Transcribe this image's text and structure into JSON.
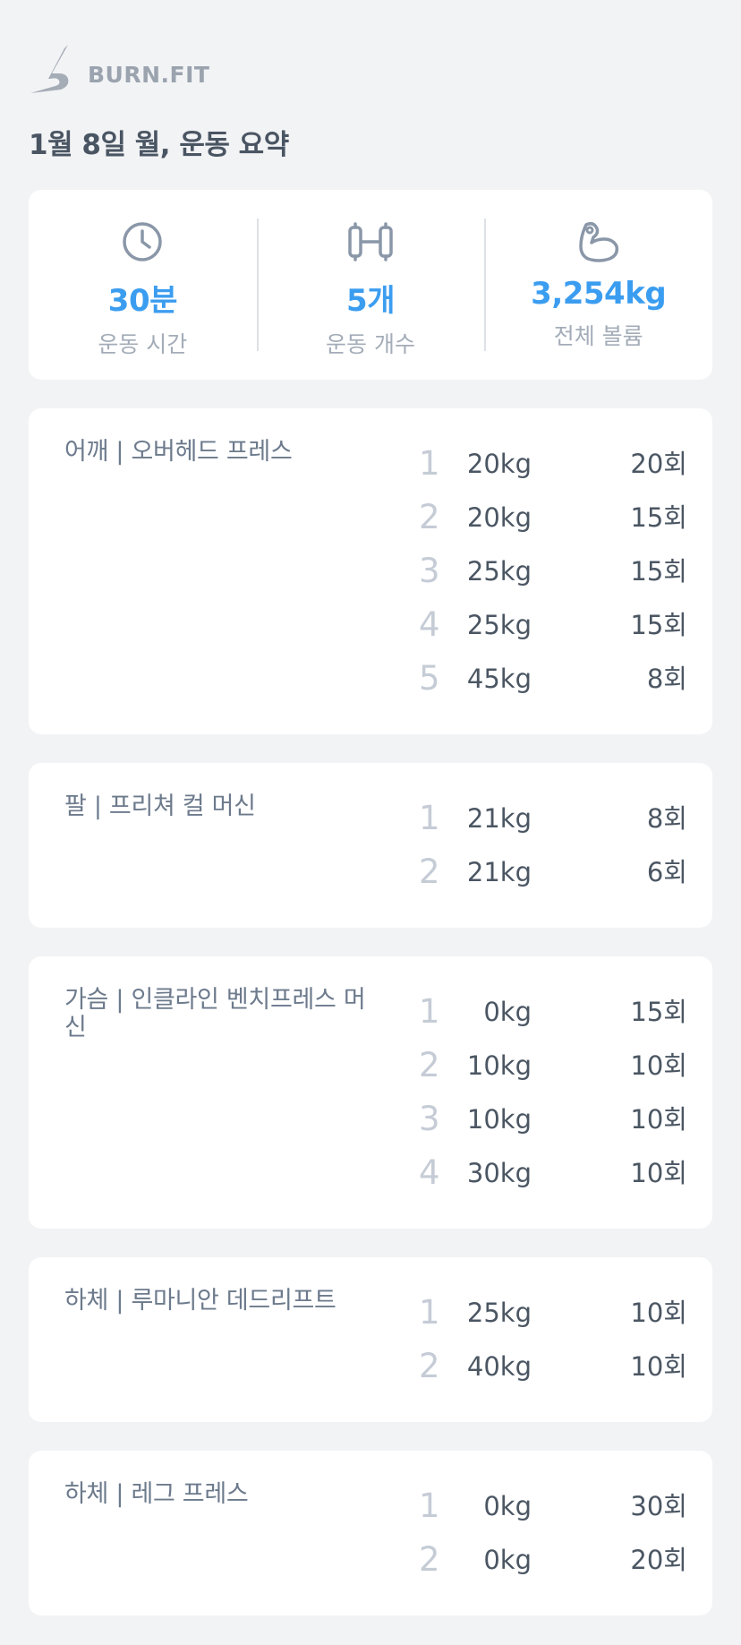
{
  "app": {
    "logo_text": "BURN.FIT"
  },
  "header": {
    "title": "1월 8일 월, 운동 요약"
  },
  "summary": {
    "time": {
      "value": "30분",
      "label": "운동 시간",
      "icon": "clock-icon"
    },
    "count": {
      "value": "5개",
      "label": "운동 개수",
      "icon": "dumbbell-icon"
    },
    "volume": {
      "value": "3,254kg",
      "label": "전체 볼륨",
      "icon": "flexed-arm-icon"
    }
  },
  "colors": {
    "accent": "#3b9df0",
    "background": "#f2f3f5",
    "card": "#ffffff"
  },
  "exercises": [
    {
      "name": "어깨 | 오버헤드 프레스",
      "sets": [
        {
          "num": "1",
          "weight": "20kg",
          "reps": "20회"
        },
        {
          "num": "2",
          "weight": "20kg",
          "reps": "15회"
        },
        {
          "num": "3",
          "weight": "25kg",
          "reps": "15회"
        },
        {
          "num": "4",
          "weight": "25kg",
          "reps": "15회"
        },
        {
          "num": "5",
          "weight": "45kg",
          "reps": "8회"
        }
      ]
    },
    {
      "name": "팔 | 프리쳐 컬 머신",
      "sets": [
        {
          "num": "1",
          "weight": "21kg",
          "reps": "8회"
        },
        {
          "num": "2",
          "weight": "21kg",
          "reps": "6회"
        }
      ]
    },
    {
      "name": "가슴 | 인클라인 벤치프레스 머신",
      "sets": [
        {
          "num": "1",
          "weight": "0kg",
          "reps": "15회"
        },
        {
          "num": "2",
          "weight": "10kg",
          "reps": "10회"
        },
        {
          "num": "3",
          "weight": "10kg",
          "reps": "10회"
        },
        {
          "num": "4",
          "weight": "30kg",
          "reps": "10회"
        }
      ]
    },
    {
      "name": "하체 | 루마니안 데드리프트",
      "sets": [
        {
          "num": "1",
          "weight": "25kg",
          "reps": "10회"
        },
        {
          "num": "2",
          "weight": "40kg",
          "reps": "10회"
        }
      ]
    },
    {
      "name": "하체 | 레그 프레스",
      "sets": [
        {
          "num": "1",
          "weight": "0kg",
          "reps": "30회"
        },
        {
          "num": "2",
          "weight": "0kg",
          "reps": "20회"
        }
      ]
    }
  ]
}
